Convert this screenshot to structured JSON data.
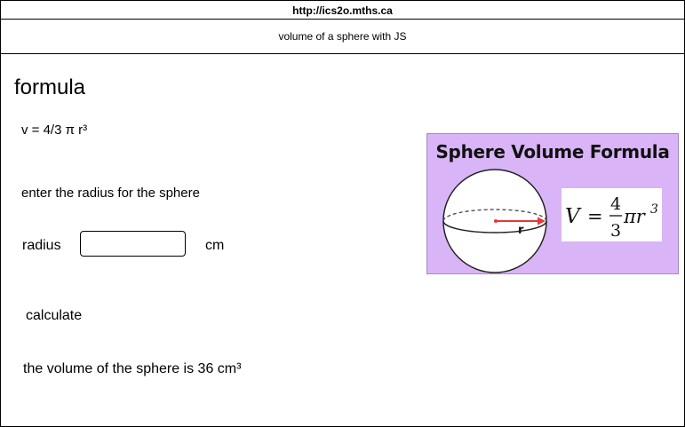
{
  "browser": {
    "url": "http://ics2o.mths.ca"
  },
  "page": {
    "title": "volume of a sphere with JS",
    "heading": "formula",
    "formula": "v = 4/3 π r³",
    "instructions": "enter the radius for the sphere",
    "radius_label": "radius",
    "radius_value": "",
    "unit_label": "cm",
    "calculate_label": "calculate",
    "result": "the volume of the sphere is 36 cm³"
  },
  "formula_image": {
    "title": "Sphere Volume Formula",
    "radius_marker": "r",
    "equation": {
      "lhs": "V",
      "equals": "=",
      "numerator": "4",
      "denominator": "3",
      "tail": "πr",
      "exponent": "3"
    },
    "colors": {
      "background": "#d9b5f7",
      "radius_arrow": "#e53935",
      "sphere_fill": "#ffffff"
    }
  }
}
